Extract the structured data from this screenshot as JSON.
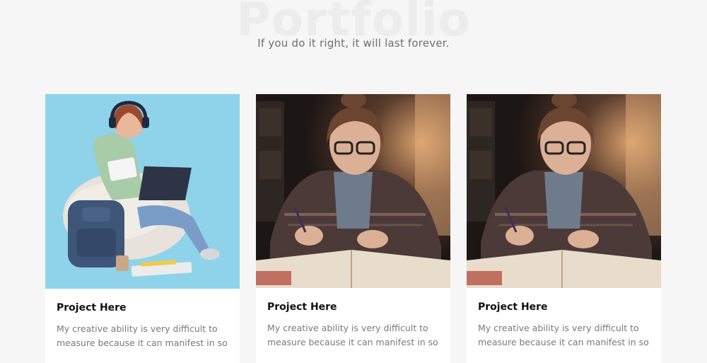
{
  "header": {
    "background_title": "Portfolio",
    "tagline": "If you do it right, it will last forever."
  },
  "projects": [
    {
      "title": "Project Here",
      "description": "My creative ability is very difficult to measure because it can manifest in so",
      "image": "student-with-laptop-on-beanbag"
    },
    {
      "title": "Project Here",
      "description": "My creative ability is very difficult to measure because it can manifest in so",
      "image": "student-writing-at-desk"
    },
    {
      "title": "Project Here",
      "description": "My creative ability is very difficult to measure because it can manifest in so",
      "image": "student-writing-at-desk"
    }
  ],
  "colors": {
    "page_background": "#f6f6f6",
    "card_background": "#ffffff",
    "title_text": "#111111",
    "body_text": "#7a7a7a",
    "image_1_background": "#8fd3ea"
  }
}
